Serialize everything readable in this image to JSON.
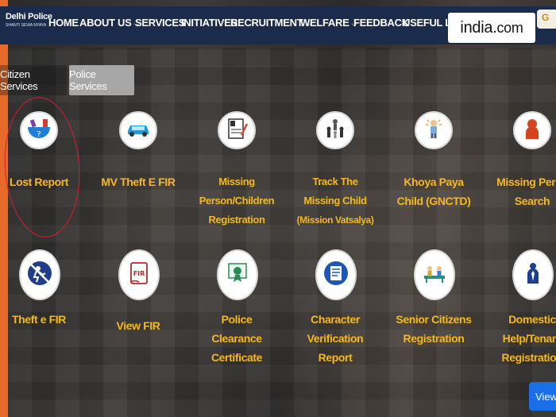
{
  "header": {
    "logo_line1": "Delhi Police",
    "logo_line2": "SHANTI SEWA NYAYA",
    "nav": [
      {
        "label": "HOME",
        "dropdown": false
      },
      {
        "label": "ABOUT US",
        "dropdown": true
      },
      {
        "label": "SERVICES",
        "dropdown": false
      },
      {
        "label": "INITIATIVES",
        "dropdown": false
      },
      {
        "label": "RECRUITMENT",
        "dropdown": true
      },
      {
        "label": "WELFARE",
        "dropdown": true
      },
      {
        "label": "FEEDBACK",
        "dropdown": false
      },
      {
        "label": "USEFUL LINK",
        "dropdown": false
      }
    ],
    "watermark": {
      "text_main": "india",
      "text_dot": ".",
      "text_com": "com"
    },
    "corner_badge": "G"
  },
  "tabs": [
    {
      "label": "Citizen Services",
      "active": true
    },
    {
      "label": "Police Services",
      "active": false
    }
  ],
  "services": [
    {
      "lines": [
        "Lost Report"
      ],
      "icon": "lost-report-icon"
    },
    {
      "lines": [
        "MV Theft E FIR"
      ],
      "icon": "car-icon"
    },
    {
      "lines": [
        "Missing",
        "Person/Children",
        "Registration"
      ],
      "icon": "missing-person-form-icon"
    },
    {
      "lines": [
        "Track The",
        "Missing Child",
        "(Mission Vatsalya)"
      ],
      "icon": "family-icon"
    },
    {
      "lines": [
        "Khoya Paya",
        "Child (GNCTD)"
      ],
      "icon": "child-icon"
    },
    {
      "lines": [
        "Missing Perso",
        "Search"
      ],
      "icon": "person-search-icon"
    },
    {
      "lines": [
        "Theft e FIR"
      ],
      "icon": "theft-icon"
    },
    {
      "lines": [
        "View FIR"
      ],
      "icon": "fir-document-icon"
    },
    {
      "lines": [
        "Police",
        "Clearance",
        "Certificate"
      ],
      "icon": "certificate-icon"
    },
    {
      "lines": [
        "Character",
        "Verification",
        "Report"
      ],
      "icon": "verification-report-icon"
    },
    {
      "lines": [
        "Senior Citizens",
        "Registration"
      ],
      "icon": "senior-citizens-icon"
    },
    {
      "lines": [
        "Domestic",
        "Help/Tenant",
        "Registration"
      ],
      "icon": "domestic-help-icon"
    }
  ],
  "view_button": "View",
  "colors": {
    "navbar": "#1b2b4b",
    "label": "#f5b820",
    "accent_orange": "#e86a2b",
    "view_button": "#1a6ee8",
    "annotation_red": "#d81f26"
  }
}
